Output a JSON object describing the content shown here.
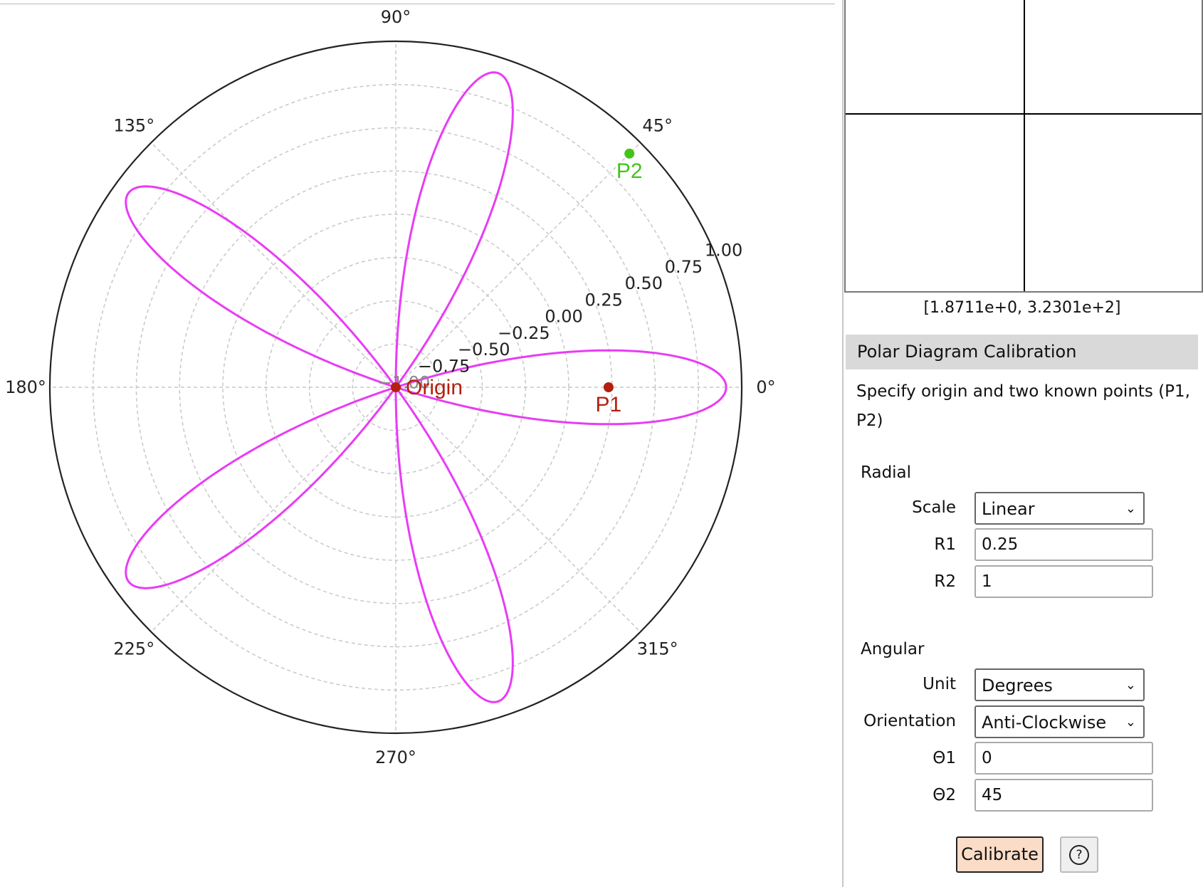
{
  "chart_data": {
    "type": "line",
    "projection": "polar",
    "rlim": [
      -1.0,
      1.0
    ],
    "r_ticks": [
      "−1.00",
      "−0.75",
      "−0.50",
      "−0.25",
      "0.00",
      "0.25",
      "0.50",
      "0.75",
      "1.00"
    ],
    "r_tick_values": [
      -1,
      -0.75,
      -0.5,
      -0.25,
      0,
      0.25,
      0.5,
      0.75,
      1
    ],
    "theta_ticks": [
      "0°",
      "45°",
      "90°",
      "135°",
      "180°",
      "225°",
      "270°",
      "315°"
    ],
    "theta_tick_values": [
      0,
      45,
      90,
      135,
      180,
      225,
      270,
      315
    ],
    "grid": true,
    "series": [
      {
        "curve": "rose",
        "petals": 5,
        "petal_angles_deg": [
          0,
          72,
          144,
          216,
          288
        ],
        "peak_r": 0.91,
        "color": "#e83cf5"
      }
    ],
    "markers": [
      {
        "label": "Origin",
        "theta": 0,
        "r": -1.0,
        "color": "#b3200f"
      },
      {
        "label": "P1",
        "theta": 0,
        "r": 0.23,
        "color": "#b3200f"
      },
      {
        "label": "P2",
        "theta": 45,
        "r": 0.91,
        "color": "#44c41a"
      }
    ]
  },
  "preview": {
    "coordinate": "[1.8711e+0, 3.2301e+2]"
  },
  "panel": {
    "title": "Polar Diagram Calibration",
    "description": "Specify origin and two known points (P1, P2)",
    "radial": {
      "heading": "Radial",
      "scale_label": "Scale",
      "scale_value": "Linear",
      "r1_label": "R1",
      "r1_value": "0.25",
      "r2_label": "R2",
      "r2_value": "1"
    },
    "angular": {
      "heading": "Angular",
      "unit_label": "Unit",
      "unit_value": "Degrees",
      "orientation_label": "Orientation",
      "orientation_value": "Anti-Clockwise",
      "t1_label": "Θ1",
      "t1_value": "0",
      "t2_label": "Θ2",
      "t2_value": "45"
    },
    "calibrate_label": "Calibrate",
    "help_label": "?"
  },
  "colors": {
    "accent_button": "#fbdcc7",
    "curve": "#e83cf5",
    "p1": "#b3200f",
    "p2": "#44c41a"
  }
}
